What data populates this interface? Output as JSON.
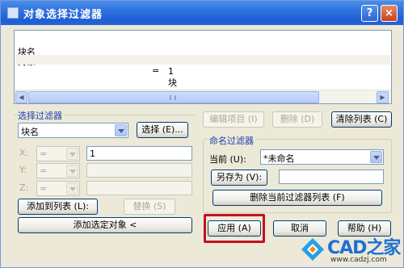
{
  "window": {
    "title": "对象选择过滤器",
    "help_btn": "?",
    "close_btn": "×"
  },
  "filter_list": {
    "rows": [
      {
        "name": "块名",
        "op": "=",
        "value": "1"
      },
      {
        "name": "对象",
        "op": "=",
        "value": "块"
      }
    ]
  },
  "select_filter": {
    "group_label": "选择过滤器",
    "type_value": "块名",
    "select_button": "选择 (E)...",
    "x_label": "X:",
    "y_label": "Y:",
    "z_label": "Z:",
    "x_op": "=",
    "y_op": "=",
    "z_op": "=",
    "x_value": "1",
    "y_value": "",
    "z_value": "",
    "add_to_list_button": "添加到列表 (L):",
    "replace_button": "替换 (S)",
    "add_selected_button": "添加选定对象 <"
  },
  "list_actions": {
    "edit_button": "编辑项目 (I)",
    "delete_button": "删除 (D)",
    "clear_button": "清除列表 (C)"
  },
  "named_filters": {
    "group_label": "命名过滤器",
    "current_label": "当前 (U):",
    "current_value": "*未命名",
    "save_as_button": "另存为 (V):",
    "save_as_value": "",
    "delete_current_button": "删除当前过滤器列表 (F)"
  },
  "footer": {
    "apply_button": "应用 (A)",
    "cancel_button": "取消",
    "help_button": "帮助 (H)"
  },
  "watermark": {
    "logo": "CAD之家",
    "url": "www.cadzj.com"
  },
  "colors": {
    "title_bar": "#2f72e0",
    "dialog_bg": "#ece9d8",
    "highlight": "#c2121f",
    "group_label": "#1a3fae"
  }
}
